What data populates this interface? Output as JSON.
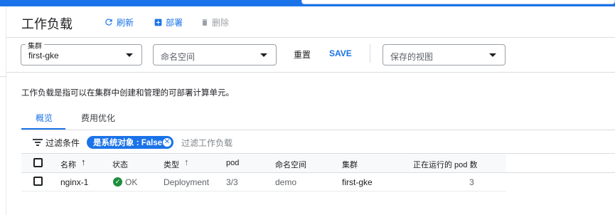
{
  "header": {
    "title": "工作负载",
    "refresh_label": "刷新",
    "deploy_label": "部署",
    "delete_label": "删除"
  },
  "filters": {
    "cluster": {
      "label": "集群",
      "value": "first-gke"
    },
    "namespace": {
      "placeholder": "命名空间"
    },
    "reset_label": "重置",
    "save_label": "SAVE",
    "saved_views": {
      "placeholder": "保存的视图"
    }
  },
  "description": "工作负载是指可以在集群中创建和管理的可部署计算单元。",
  "tabs": [
    {
      "label": "概览",
      "active": true
    },
    {
      "label": "费用优化",
      "active": false
    }
  ],
  "filter_bar": {
    "label": "过滤条件",
    "chip": "是系统对象 : False",
    "input_placeholder": "过滤工作负载"
  },
  "table": {
    "columns": [
      "名称",
      "状态",
      "类型",
      "pod",
      "命名空间",
      "集群",
      "正在运行的 pod 数"
    ],
    "rows": [
      {
        "name": "nginx-1",
        "status": "OK",
        "type": "Deployment",
        "pods": "3/3",
        "namespace": "demo",
        "cluster": "first-gke",
        "running_pods": "3"
      }
    ]
  },
  "colors": {
    "accent": "#1a73e8",
    "status_ok": "#1e8e3e",
    "text": "#202124",
    "muted": "#5f6368"
  },
  "icons": [
    "refresh-icon",
    "add-box-icon",
    "trash-icon",
    "chevron-down-icon",
    "filter-icon",
    "close-circle-icon",
    "arrow-up-icon",
    "check-circle-icon"
  ]
}
